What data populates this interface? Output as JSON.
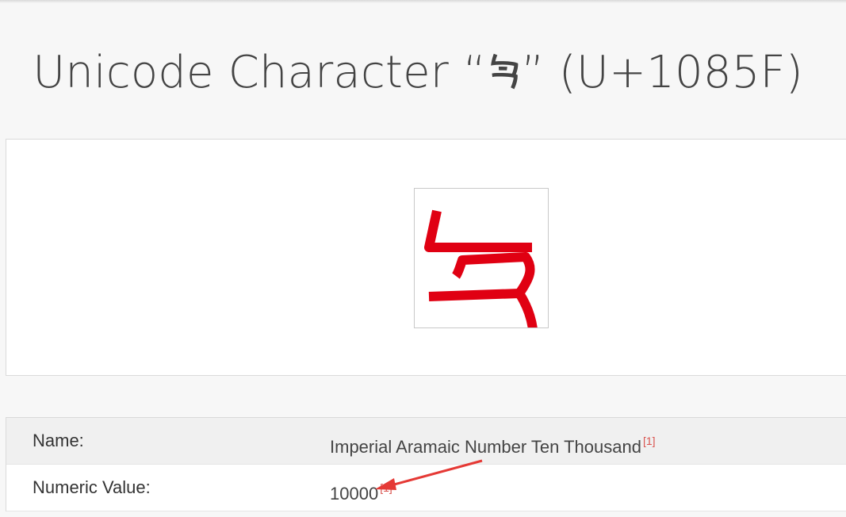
{
  "page": {
    "title": "Unicode Character “𐡟” (U+1085F)"
  },
  "glyph": {
    "character": "𐡟",
    "color": "#e00012"
  },
  "properties": [
    {
      "label": "Name:",
      "value": "Imperial Aramaic Number Ten Thousand",
      "ref": "[1]"
    },
    {
      "label": "Numeric Value:",
      "value": "10000",
      "ref": "[1]"
    }
  ],
  "annotation": {
    "type": "arrow",
    "color": "#e53935",
    "points_to": "numeric-value"
  }
}
